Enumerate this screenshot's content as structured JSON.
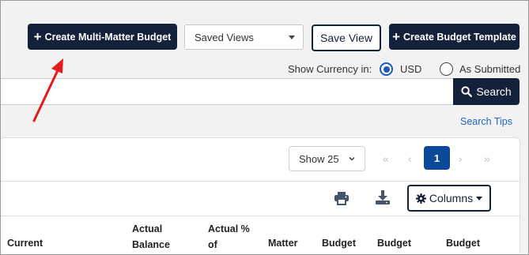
{
  "toolbar": {
    "create_multi_matter_label": "Create Multi-Matter Budget",
    "saved_views_label": "Saved Views",
    "save_view_label": "Save View",
    "create_template_label": "Create Budget Template"
  },
  "currency": {
    "label": "Show Currency in:",
    "options": [
      {
        "label": "USD",
        "checked": true
      },
      {
        "label": "As Submitted",
        "checked": false
      }
    ]
  },
  "search": {
    "button_label": "Search",
    "tips_label": "Search Tips"
  },
  "pagination": {
    "show_label": "Show 25",
    "first": "«",
    "prev": "‹",
    "current_page": "1",
    "next": "›",
    "last": "»"
  },
  "table_tools": {
    "columns_label": "Columns"
  },
  "table": {
    "headers": [
      [
        "Current"
      ],
      [
        "Actual",
        "Balance"
      ],
      [
        "Actual %",
        "of"
      ],
      [
        "Matter"
      ],
      [
        "Budget"
      ],
      [
        "Budget"
      ],
      [
        "Budget"
      ]
    ]
  },
  "icons": {
    "plus": "plus-icon",
    "search": "search-icon",
    "print": "print-icon",
    "download": "download-icon",
    "gear": "gear-icon"
  },
  "colors": {
    "primary": "#14213a",
    "accent": "#1a5bb8",
    "page_active": "#0b4a99",
    "link": "#1f64c0",
    "annotation_arrow": "#e31b1b"
  }
}
